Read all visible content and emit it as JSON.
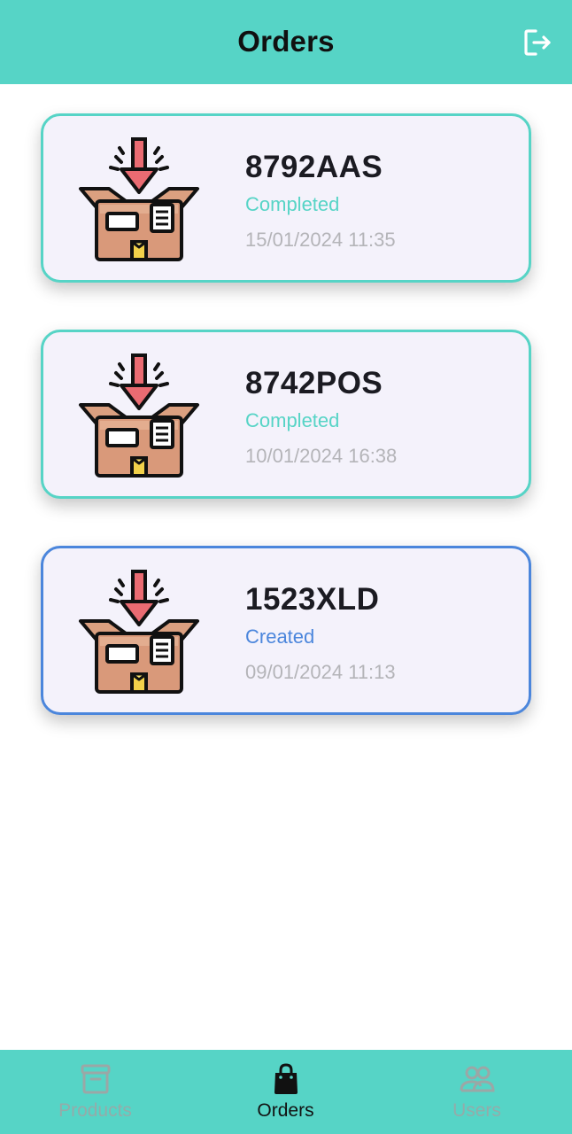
{
  "header": {
    "title": "Orders",
    "logout_icon": "logout-icon"
  },
  "orders": [
    {
      "id": "8792AAS",
      "status": "Completed",
      "datetime": "15/01/2024 11:35",
      "icon": "package-receive-icon",
      "accent_color": "#56d4c6"
    },
    {
      "id": "8742POS",
      "status": "Completed",
      "datetime": "10/01/2024 16:38",
      "icon": "package-receive-icon",
      "accent_color": "#56d4c6"
    },
    {
      "id": "1523XLD",
      "status": "Created",
      "datetime": "09/01/2024 11:13",
      "icon": "package-receive-icon",
      "accent_color": "#4b86dc"
    }
  ],
  "bottom_nav": {
    "items": [
      {
        "label": "Products",
        "icon": "archive-box-icon",
        "active": false
      },
      {
        "label": "Orders",
        "icon": "shopping-bag-icon",
        "active": true
      },
      {
        "label": "Users",
        "icon": "users-icon",
        "active": false
      }
    ]
  },
  "colors": {
    "primary": "#56d4c6",
    "created": "#4b86dc",
    "card_background": "#f4f2fb",
    "inactive_nav": "#e07b87"
  }
}
